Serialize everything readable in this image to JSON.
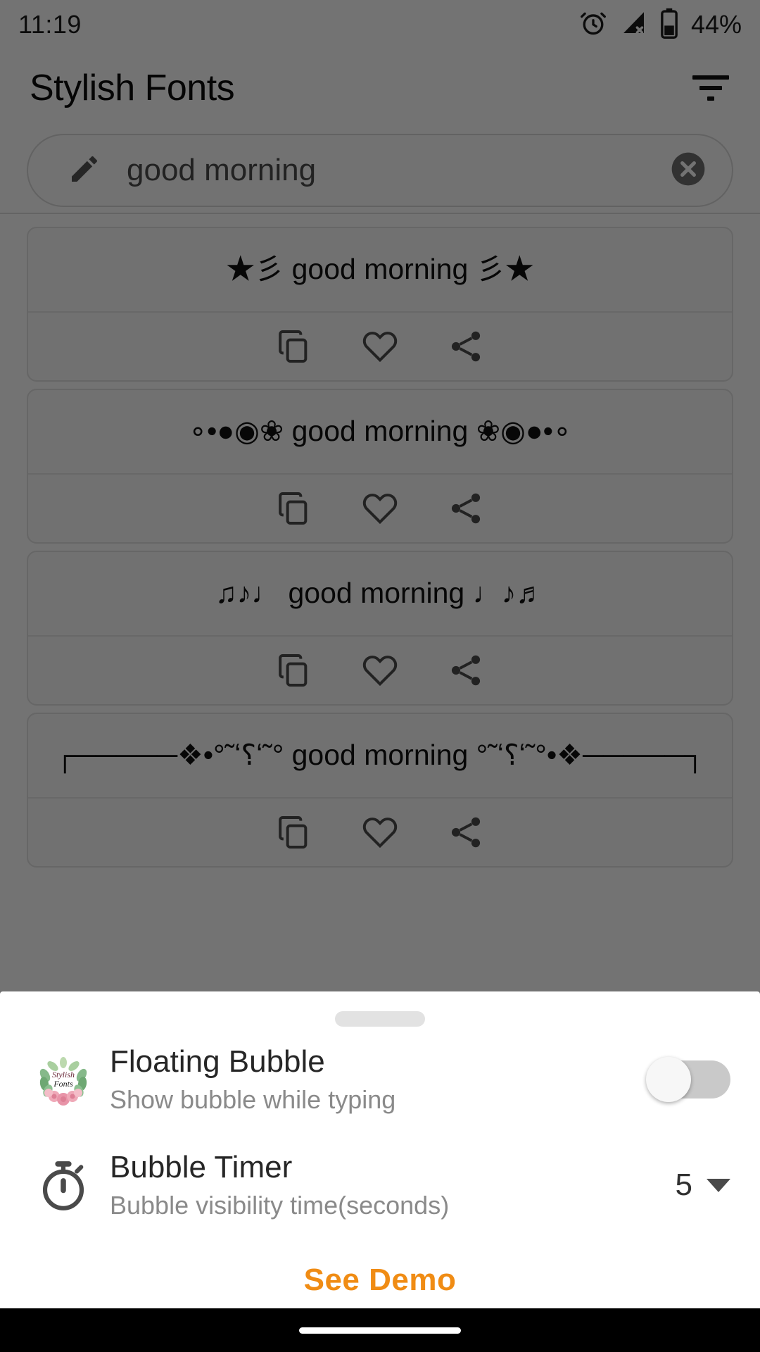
{
  "status_bar": {
    "time": "11:19",
    "battery_percent": "44%",
    "icons": [
      "alarm-icon",
      "signal-off-icon",
      "battery-icon"
    ]
  },
  "app_bar": {
    "title": "Stylish Fonts",
    "filter_icon": "filter-icon"
  },
  "search": {
    "value": "good morning",
    "leading_icon": "pencil-icon",
    "clear_icon": "clear-circle-icon"
  },
  "cards": [
    {
      "text": "★彡 good morning 彡★",
      "actions": [
        "copy-icon",
        "heart-icon",
        "share-icon"
      ]
    },
    {
      "text": "∘•●◉❀ good morning ❀◉●•∘",
      "actions": [
        "copy-icon",
        "heart-icon",
        "share-icon"
      ]
    },
    {
      "text": "♫♪♩ good morning ♩♪♬",
      "actions": [
        "copy-icon",
        "heart-icon",
        "share-icon"
      ]
    },
    {
      "text": "┌─────❖•°˜ʻ؟ʻ˜°  good morning  °˜ʻ؟ʻ˜°•❖─────┐",
      "actions": [
        "copy-icon",
        "heart-icon",
        "share-icon"
      ]
    }
  ],
  "bottom_sheet": {
    "handle": "drag-handle",
    "rows": [
      {
        "icon": "app-logo-icon",
        "title": "Floating Bubble",
        "subtitle": "Show bubble while typing",
        "control": "toggle",
        "toggle_on": false
      },
      {
        "icon": "stopwatch-icon",
        "title": "Bubble Timer",
        "subtitle": "Bubble visibility time(seconds)",
        "control": "dropdown",
        "value": "5"
      }
    ],
    "see_demo_label": "See Demo"
  },
  "colors": {
    "accent_orange": "#F08C14",
    "scrim": "rgba(0,0,0,0.55)",
    "sheet_bg": "#FFFFFF",
    "nav_bar": "#000000"
  },
  "nav_bar": {
    "pill": "gesture-pill"
  }
}
